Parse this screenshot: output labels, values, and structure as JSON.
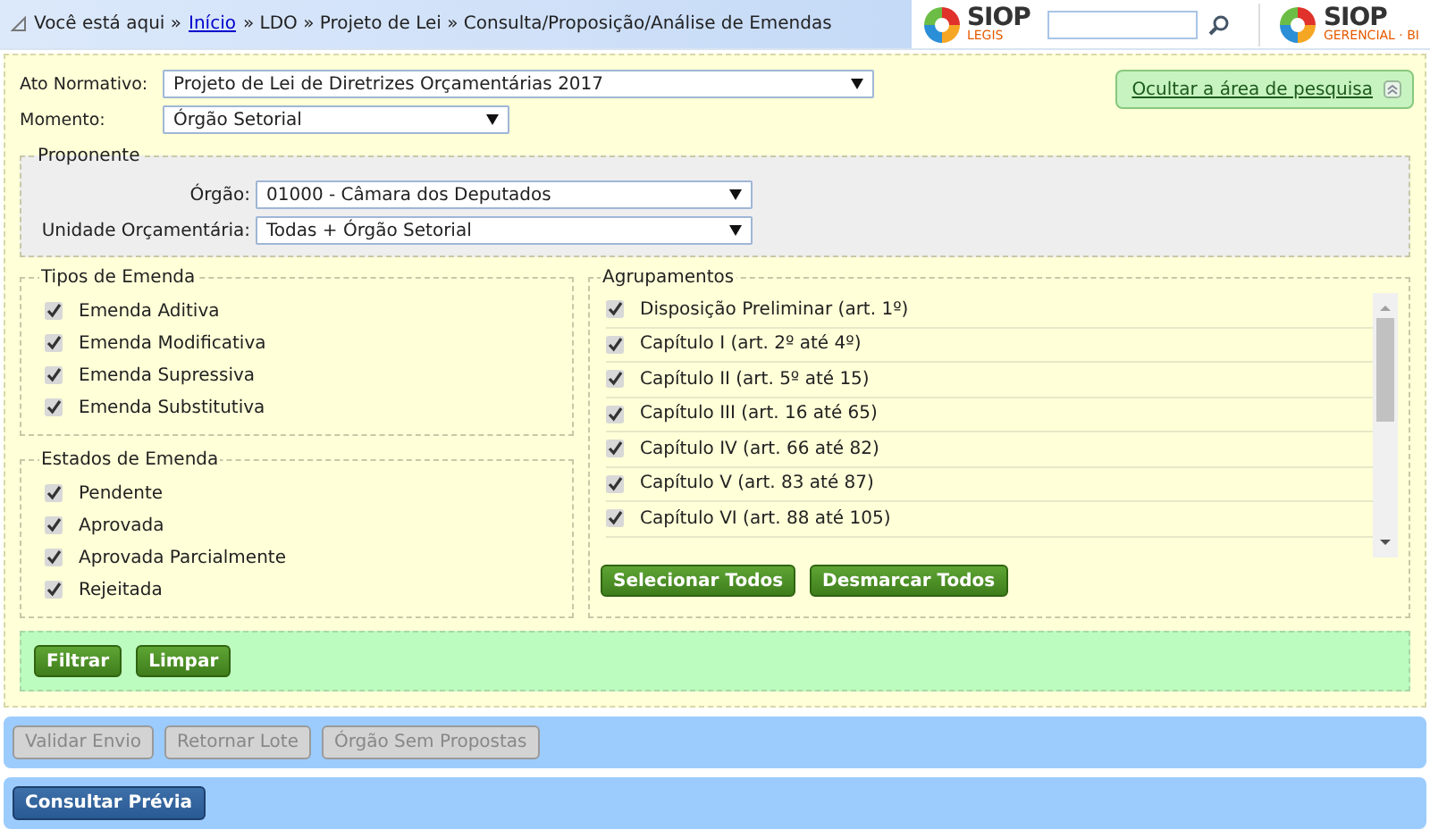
{
  "header": {
    "breadcrumb_prefix": "Você está aqui »",
    "breadcrumb_link": "Início",
    "breadcrumb_trail": "» LDO » Projeto de Lei » Consulta/Proposição/Análise de Emendas",
    "logos": [
      {
        "name": "SIOP",
        "sub": "LEGIS"
      },
      {
        "name": "SIOP",
        "sub": "GERENCIAL · BI"
      }
    ]
  },
  "search": {
    "toggle_link": "Ocultar a área de pesquisa",
    "fields": [
      {
        "label": "Ato Normativo:",
        "value": "Projeto de Lei de Diretrizes Orçamentárias 2017"
      },
      {
        "label": "Momento:",
        "value": "Órgão Setorial"
      }
    ],
    "proponente": {
      "legend": "Proponente",
      "fields": [
        {
          "label": "Órgão:",
          "value": "01000 - Câmara dos Deputados"
        },
        {
          "label": "Unidade Orçamentária:",
          "value": "Todas + Órgão Setorial"
        }
      ]
    },
    "tipos": {
      "legend": "Tipos de Emenda",
      "items": [
        {
          "label": "Emenda Aditiva",
          "checked": true
        },
        {
          "label": "Emenda Modificativa",
          "checked": true
        },
        {
          "label": "Emenda Supressiva",
          "checked": true
        },
        {
          "label": "Emenda Substitutiva",
          "checked": true
        }
      ]
    },
    "estados": {
      "legend": "Estados de Emenda",
      "items": [
        {
          "label": "Pendente",
          "checked": true
        },
        {
          "label": "Aprovada",
          "checked": true
        },
        {
          "label": "Aprovada Parcialmente",
          "checked": true
        },
        {
          "label": "Rejeitada",
          "checked": true
        }
      ]
    },
    "agrupamentos": {
      "legend": "Agrupamentos",
      "items": [
        {
          "label": "Disposição Preliminar (art. 1º)",
          "checked": true
        },
        {
          "label": "Capítulo I (art. 2º até 4º)",
          "checked": true
        },
        {
          "label": "Capítulo II (art. 5º até 15)",
          "checked": true
        },
        {
          "label": "Capítulo III (art. 16 até 65)",
          "checked": true
        },
        {
          "label": "Capítulo IV (art. 66 até 82)",
          "checked": true
        },
        {
          "label": "Capítulo V (art. 83 até 87)",
          "checked": true
        },
        {
          "label": "Capítulo VI (art. 88 até 105)",
          "checked": true
        }
      ],
      "buttons": [
        "Selecionar Todos",
        "Desmarcar Todos"
      ]
    },
    "filter_buttons": [
      "Filtrar",
      "Limpar"
    ]
  },
  "action_bar": {
    "buttons": [
      {
        "label": "Validar Envio",
        "disabled": true
      },
      {
        "label": "Retornar Lote",
        "disabled": true
      },
      {
        "label": "Órgão Sem Propostas",
        "disabled": true
      }
    ]
  },
  "preview_bar": {
    "buttons": [
      {
        "label": "Consultar Prévia",
        "disabled": false
      }
    ]
  }
}
